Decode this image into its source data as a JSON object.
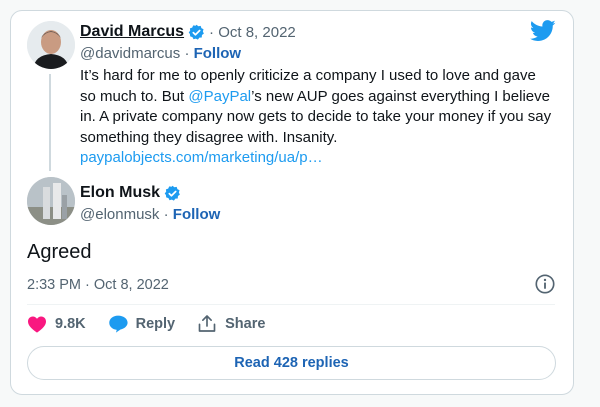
{
  "quoted_tweet": {
    "name": "David Marcus",
    "date": "· Oct 8, 2022",
    "handle": "@davidmarcus",
    "follow": "Follow",
    "text_1": "It’s hard for me to openly criticize a company I used to love and gave so much to. But ",
    "mention": "@PayPal",
    "text_2": "’s new AUP goes against everything I believe in. A private company now gets to decide to take your money if you say something they disagree with. Insanity.",
    "link": "paypalobjects.com/marketing/ua/p…"
  },
  "main_tweet": {
    "name": "Elon Musk",
    "handle": "@elonmusk",
    "follow": "Follow",
    "text": "Agreed",
    "timestamp": "2:33 PM · Oct 8, 2022"
  },
  "actions": {
    "likes": "9.8K",
    "reply": "Reply",
    "share": "Share"
  },
  "read_replies": "Read 428 replies",
  "colors": {
    "link": "#1d9bf0",
    "follow": "#1d64b4",
    "like": "#f91880",
    "verified": "#1d9bf0"
  },
  "icons": [
    "twitter-bird-icon",
    "verified-badge-icon",
    "info-icon",
    "heart-icon",
    "reply-bubble-icon",
    "share-icon"
  ]
}
